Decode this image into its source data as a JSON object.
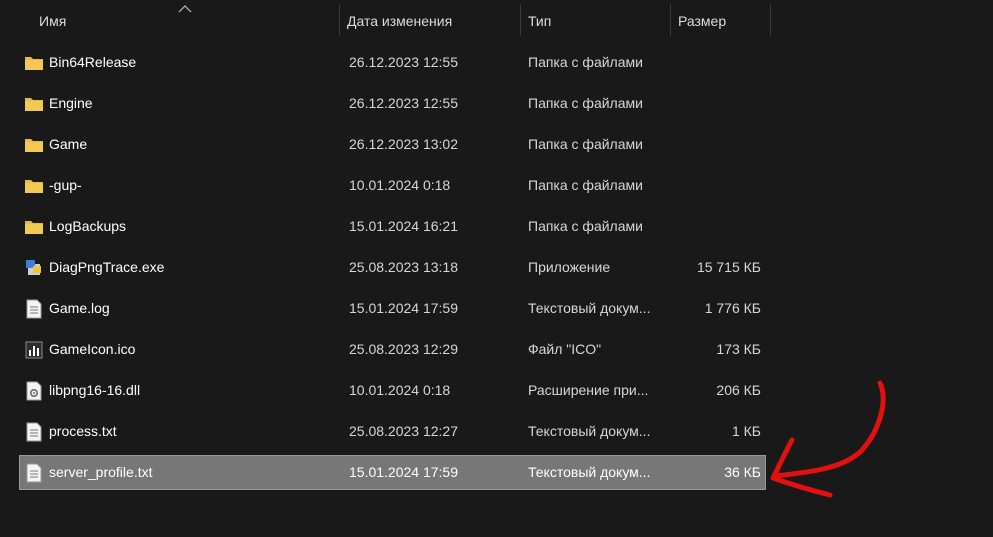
{
  "columns": {
    "name": "Имя",
    "date": "Дата изменения",
    "type": "Тип",
    "size": "Размер"
  },
  "files": [
    {
      "name": "Bin64Release",
      "date": "26.12.2023 12:55",
      "type": "Папка с файлами",
      "size": "",
      "icon": "folder-icon"
    },
    {
      "name": "Engine",
      "date": "26.12.2023 12:55",
      "type": "Папка с файлами",
      "size": "",
      "icon": "folder-icon"
    },
    {
      "name": "Game",
      "date": "26.12.2023 13:02",
      "type": "Папка с файлами",
      "size": "",
      "icon": "folder-icon"
    },
    {
      "name": "-gup-",
      "date": "10.01.2024 0:18",
      "type": "Папка с файлами",
      "size": "",
      "icon": "folder-icon"
    },
    {
      "name": "LogBackups",
      "date": "15.01.2024 16:21",
      "type": "Папка с файлами",
      "size": "",
      "icon": "folder-icon"
    },
    {
      "name": "DiagPngTrace.exe",
      "date": "25.08.2023 13:18",
      "type": "Приложение",
      "size": "15 715 КБ",
      "icon": "exe-icon"
    },
    {
      "name": "Game.log",
      "date": "15.01.2024 17:59",
      "type": "Текстовый докум...",
      "size": "1 776 КБ",
      "icon": "text-file-icon"
    },
    {
      "name": "GameIcon.ico",
      "date": "25.08.2023 12:29",
      "type": "Файл \"ICO\"",
      "size": "173 КБ",
      "icon": "ico-file-icon"
    },
    {
      "name": "libpng16-16.dll",
      "date": "10.01.2024 0:18",
      "type": "Расширение при...",
      "size": "206 КБ",
      "icon": "dll-file-icon"
    },
    {
      "name": "process.txt",
      "date": "25.08.2023 12:27",
      "type": "Текстовый докум...",
      "size": "1 КБ",
      "icon": "text-file-icon"
    },
    {
      "name": "server_profile.txt",
      "date": "15.01.2024 17:59",
      "type": "Текстовый докум...",
      "size": "36 КБ",
      "icon": "text-file-icon",
      "selected": true
    }
  ],
  "colors": {
    "background": "#191919",
    "selection": "#777777",
    "folder": "#e8b84a",
    "annotation_arrow": "#e31010"
  }
}
